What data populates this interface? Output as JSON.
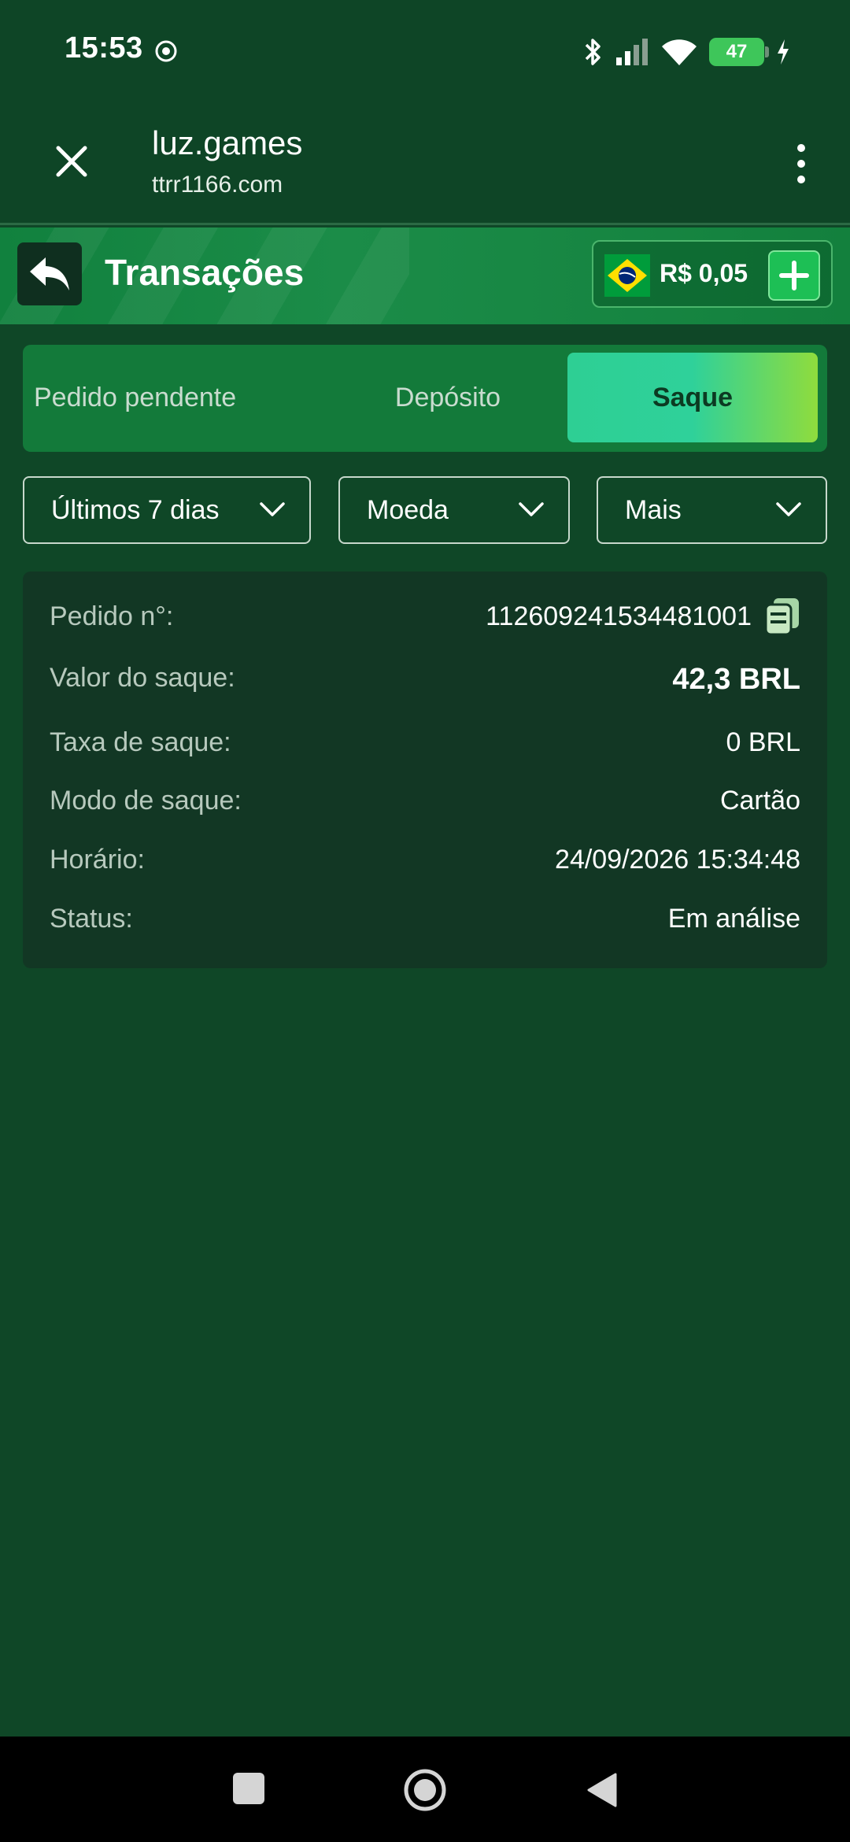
{
  "status_bar": {
    "time": "15:53",
    "battery": "47"
  },
  "browser": {
    "site_title": "luz.games",
    "url": "ttrr1166.com"
  },
  "header": {
    "title": "Transações",
    "balance": "R$ 0,05"
  },
  "tabs": [
    {
      "label": "Pedido pendente",
      "active": false
    },
    {
      "label": "Depósito",
      "active": false
    },
    {
      "label": "Saque",
      "active": true
    }
  ],
  "filters": {
    "period": "Últimos 7 dias",
    "currency": "Moeda",
    "more": "Mais"
  },
  "transaction": {
    "order_label": "Pedido n°:",
    "order_value": "112609241534481001",
    "amount_label": "Valor do saque:",
    "amount_value": "42,3 BRL",
    "fee_label": "Taxa de saque:",
    "fee_value": "0 BRL",
    "mode_label": "Modo de saque:",
    "mode_value": "Cartão",
    "time_label": "Horário:",
    "time_value": "24/09/2026 15:34:48",
    "status_label": "Status:",
    "status_value": "Em análise"
  },
  "colors": {
    "background": "#0f4727",
    "header_green": "#13803d",
    "tab_active_start": "#2ecf94",
    "tab_active_end": "#8fdc3d",
    "card": "#123724"
  }
}
